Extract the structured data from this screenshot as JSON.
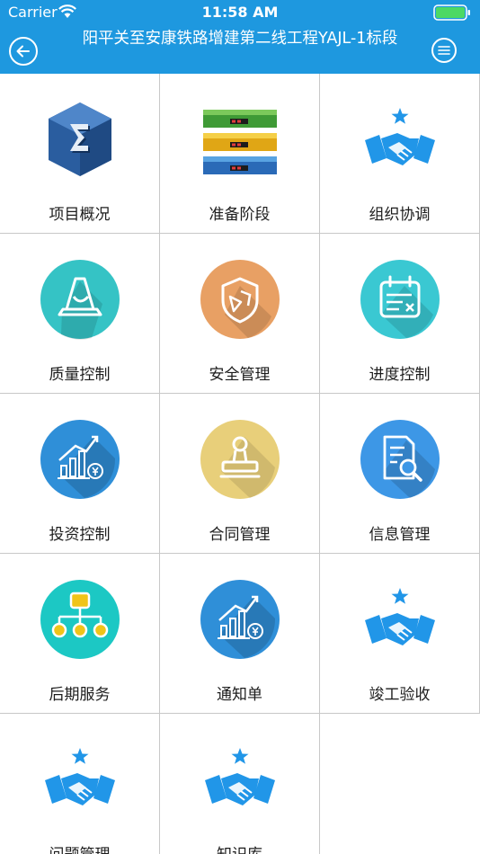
{
  "status_bar": {
    "carrier": "Carrier",
    "time": "11:58 AM"
  },
  "nav": {
    "title": "阳平关至安康铁路增建第二线工程YAJL-1标段"
  },
  "menu": {
    "items": [
      {
        "label": "项目概况",
        "icon": "sigma-cube-icon"
      },
      {
        "label": "准备阶段",
        "icon": "server-stack-icon"
      },
      {
        "label": "组织协调",
        "icon": "handshake-icon"
      },
      {
        "label": "质量控制",
        "icon": "traffic-cone-icon"
      },
      {
        "label": "安全管理",
        "icon": "shield-icon"
      },
      {
        "label": "进度控制",
        "icon": "calendar-icon"
      },
      {
        "label": "投资控制",
        "icon": "investment-chart-icon"
      },
      {
        "label": "合同管理",
        "icon": "stamp-icon"
      },
      {
        "label": "信息管理",
        "icon": "document-search-icon"
      },
      {
        "label": "后期服务",
        "icon": "org-chart-icon"
      },
      {
        "label": "通知单",
        "icon": "investment-chart-icon"
      },
      {
        "label": "竣工验收",
        "icon": "handshake-icon"
      },
      {
        "label": "问题管理",
        "icon": "handshake-icon"
      },
      {
        "label": "知识库",
        "icon": "handshake-icon"
      }
    ]
  },
  "colors": {
    "header": "#1e98df",
    "teal": "#35c3c5",
    "orange": "#e8a064",
    "cyan": "#3ac8d2",
    "blue": "#2f8fd8",
    "yellow": "#e8cf7a",
    "skyblue": "#3d97e6",
    "turquoise": "#1cc8c4",
    "handshake": "#2196e8"
  }
}
